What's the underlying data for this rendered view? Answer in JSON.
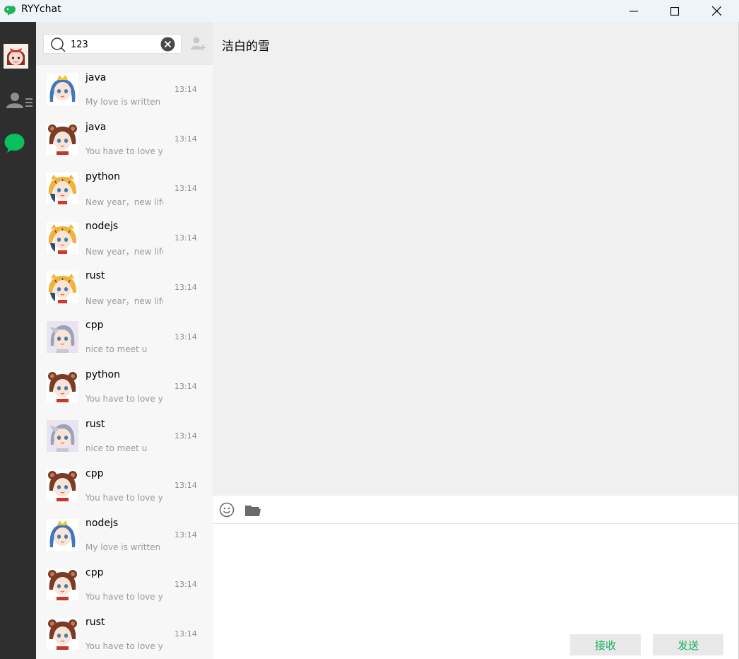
{
  "window": {
    "title": "RYYchat",
    "logo_icon": "app-bird-logo-icon",
    "controls": [
      "minimize-icon",
      "maximize-icon",
      "close-icon"
    ]
  },
  "leftnav": {
    "items": [
      {
        "name": "nav-avatar",
        "icon": "user-avatar-icon"
      },
      {
        "name": "nav-contacts",
        "icon": "contacts-icon"
      },
      {
        "name": "nav-chat",
        "icon": "chat-bubble-icon",
        "active_color": "#07c160"
      }
    ]
  },
  "search": {
    "value": "123",
    "placeholder": "",
    "icon": "search-icon",
    "clear_icon": "clear-icon",
    "add_friend_icon": "add-friend-icon"
  },
  "chats": [
    {
      "name": "java",
      "preview": "My love is written i",
      "time": "13:14",
      "avatar": "blue-crown-girl-avatar"
    },
    {
      "name": "java",
      "preview": "You have to love yo",
      "time": "13:14",
      "avatar": "bear-hat-girl-avatar"
    },
    {
      "name": "python",
      "preview": "New year，new life",
      "time": "13:14",
      "avatar": "tiger-hat-girl-avatar"
    },
    {
      "name": "nodejs",
      "preview": "New year，new life",
      "time": "13:14",
      "avatar": "tiger-hat-girl-avatar"
    },
    {
      "name": "rust",
      "preview": "New year，new life",
      "time": "13:14",
      "avatar": "tiger-hat-girl-avatar"
    },
    {
      "name": "cpp",
      "preview": "nice to meet u",
      "time": "13:14",
      "avatar": "sketch-girl-avatar"
    },
    {
      "name": "python",
      "preview": "You have to love yo",
      "time": "13:14",
      "avatar": "bear-hat-girl-avatar"
    },
    {
      "name": "rust",
      "preview": "nice to meet u",
      "time": "13:14",
      "avatar": "sketch-girl-avatar"
    },
    {
      "name": "cpp",
      "preview": "You have to love yo",
      "time": "13:14",
      "avatar": "bear-hat-girl-avatar"
    },
    {
      "name": "nodejs",
      "preview": "My love is written i",
      "time": "13:14",
      "avatar": "blue-crown-girl-avatar"
    },
    {
      "name": "cpp",
      "preview": "You have to love yo",
      "time": "13:14",
      "avatar": "bear-hat-girl-avatar"
    },
    {
      "name": "rust",
      "preview": "You have to love yo",
      "time": "13:14",
      "avatar": "bear-hat-girl-avatar"
    }
  ],
  "conversation": {
    "title": "洁白的雪",
    "toolbar": [
      "emoji-icon",
      "folder-icon"
    ],
    "receive_label": "接收",
    "send_label": "发送",
    "accent_color": "#17ae5d"
  }
}
